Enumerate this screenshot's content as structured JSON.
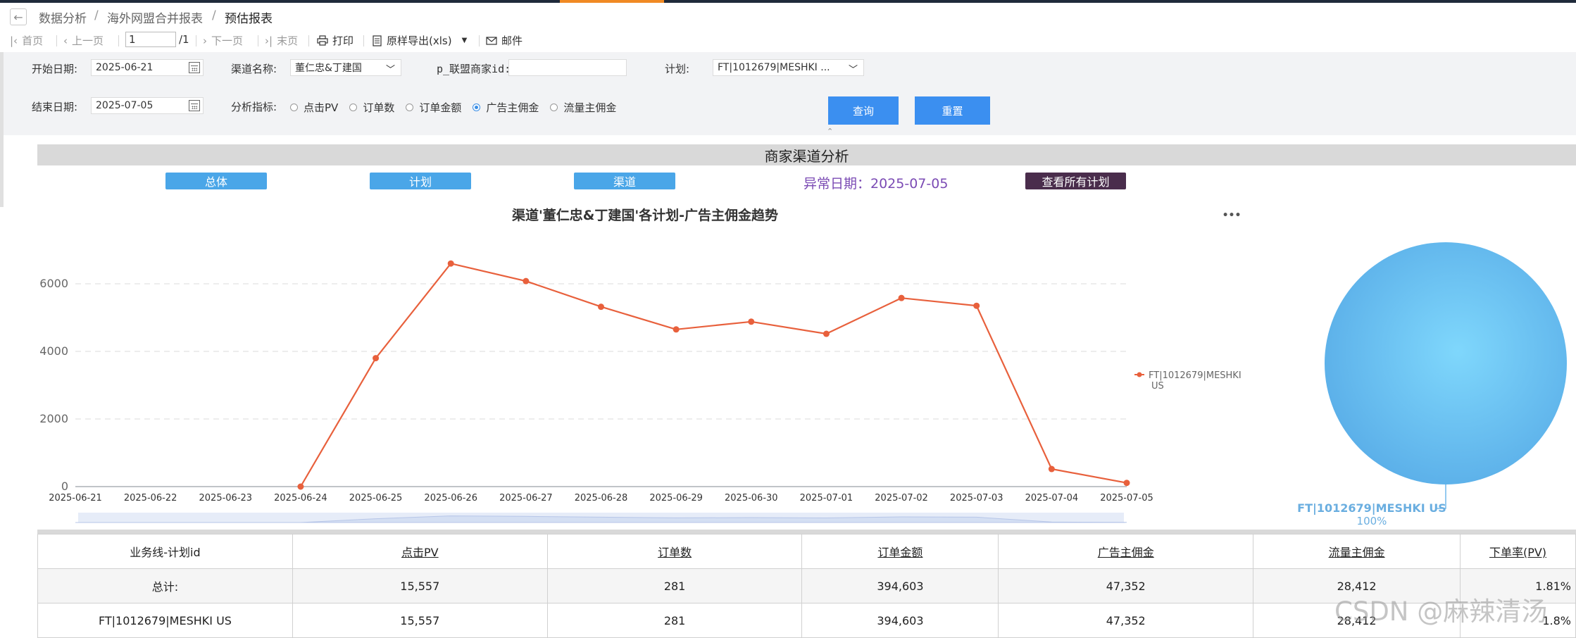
{
  "breadcrumb": {
    "items": [
      "数据分析",
      "海外网盟合并报表",
      "预估报表"
    ],
    "separator": "/"
  },
  "toolbar": {
    "first": "首页",
    "prev": "上一页",
    "page_value": "1",
    "page_total": "/1",
    "next": "下一页",
    "last": "末页",
    "print": "打印",
    "export": "原样导出(xls)",
    "mail": "邮件"
  },
  "filters": {
    "start_date_label": "开始日期:",
    "start_date": "2025-06-21",
    "end_date_label": "结束日期:",
    "end_date": "2025-07-05",
    "channel_label": "渠道名称:",
    "channel_value": "董仁忠&丁建国",
    "merchant_label": "p_联盟商家id:",
    "merchant_value": "",
    "plan_label": "计划:",
    "plan_value": "FT|1012679|MESHKI ...",
    "metric_label": "分析指标:",
    "metrics": [
      {
        "label": "点击PV",
        "selected": false
      },
      {
        "label": "订单数",
        "selected": false
      },
      {
        "label": "订单金额",
        "selected": false
      },
      {
        "label": "广告主佣金",
        "selected": true
      },
      {
        "label": "流量主佣金",
        "selected": false
      }
    ],
    "query_label": "查询",
    "reset_label": "重置",
    "collapse_glyph": "⌃"
  },
  "report": {
    "title": "商家渠道分析",
    "tabs": [
      "总体",
      "计划",
      "渠道"
    ],
    "abnormal_date": "异常日期：2025-07-05",
    "view_all_label": "查看所有计划",
    "menu_glyph": "•••"
  },
  "colors": {
    "line": "#e8603c",
    "pie": "#5cb6ee",
    "button": "#3b8ff0",
    "tab": "#4aa6e8"
  },
  "chart_data": [
    {
      "type": "line",
      "title": "渠道'董仁忠&丁建国'各计划-广告主佣金趋势",
      "x": [
        "2025-06-21",
        "2025-06-22",
        "2025-06-23",
        "2025-06-24",
        "2025-06-25",
        "2025-06-26",
        "2025-06-27",
        "2025-06-28",
        "2025-06-29",
        "2025-06-30",
        "2025-07-01",
        "2025-07-02",
        "2025-07-03",
        "2025-07-04",
        "2025-07-05"
      ],
      "series": [
        {
          "name": "FT|1012679|MESHKI US",
          "values": [
            null,
            null,
            null,
            0,
            3800,
            6600,
            6080,
            5320,
            4650,
            4880,
            4520,
            5580,
            5350,
            520,
            110
          ]
        }
      ],
      "ylim": [
        0,
        7000
      ],
      "yticks": [
        0,
        2000,
        4000,
        6000
      ],
      "grid": true,
      "legend": "right"
    },
    {
      "type": "pie",
      "slices": [
        {
          "label": "FT|1012679|MESHKI US",
          "percent": "100%",
          "value": 100
        }
      ]
    }
  ],
  "table": {
    "headers": [
      "业务线-计划id",
      "点击PV",
      "订单数",
      "订单金额",
      "广告主佣金",
      "流量主佣金",
      "下单率(PV)"
    ],
    "rows": [
      [
        "总计:",
        "15,557",
        "281",
        "394,603",
        "47,352",
        "28,412",
        "1.81%"
      ],
      [
        "FT|1012679|MESHKI US",
        "15,557",
        "281",
        "394,603",
        "47,352",
        "28,412",
        "1.8%"
      ]
    ]
  },
  "watermark": "CSDN @麻辣清汤"
}
